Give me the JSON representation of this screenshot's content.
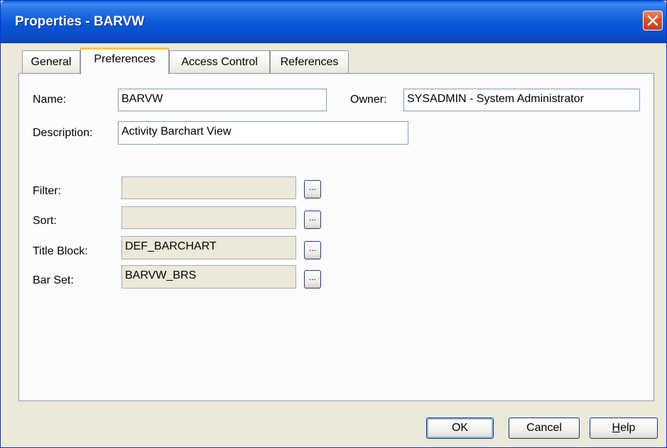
{
  "window": {
    "title": "Properties - BARVW",
    "close_icon": "close-icon"
  },
  "tabs": [
    {
      "label": "General",
      "active": false
    },
    {
      "label": "Preferences",
      "active": true
    },
    {
      "label": "Access Control",
      "active": false
    },
    {
      "label": "References",
      "active": false
    }
  ],
  "form": {
    "name_label": "Name:",
    "name_value": "BARVW",
    "owner_label": "Owner:",
    "owner_value": "SYSADMIN - System Administrator",
    "description_label": "Description:",
    "description_value": "Activity Barchart View",
    "filter_label": "Filter:",
    "filter_value": "",
    "sort_label": "Sort:",
    "sort_value": "",
    "title_block_label": "Title Block:",
    "title_block_value": "DEF_BARCHART",
    "bar_set_label": "Bar Set:",
    "bar_set_value": "BARVW_BRS",
    "browse_label": "..."
  },
  "buttons": {
    "ok": "OK",
    "cancel": "Cancel",
    "help_first": "H",
    "help_rest": "elp"
  },
  "colors": {
    "titlebar": "#0a56d6",
    "dialog_bg": "#ece9d8",
    "active_tab_accent": "#ffc83c",
    "close_button": "#d9532d"
  }
}
